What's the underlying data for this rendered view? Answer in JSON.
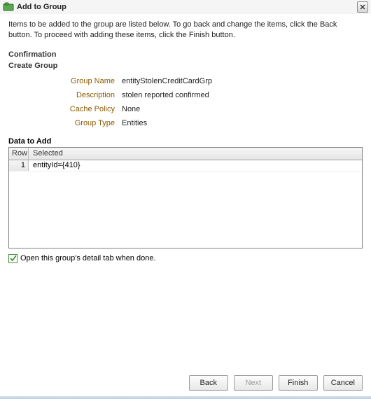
{
  "dialog": {
    "title": "Add to Group",
    "intro": "Items to be added to the group are listed below. To go back and change the items, click the Back button. To proceed with adding these items, click the Finish button."
  },
  "confirmation": {
    "heading": "Confirmation",
    "subheading": "Create Group",
    "fields": {
      "group_name": {
        "label": "Group Name",
        "value": "entityStolenCreditCardGrp"
      },
      "description": {
        "label": "Description",
        "value": "stolen reported confirmed"
      },
      "cache_policy": {
        "label": "Cache Policy",
        "value": "None"
      },
      "group_type": {
        "label": "Group Type",
        "value": "Entities"
      }
    }
  },
  "data_to_add": {
    "heading": "Data to Add",
    "columns": {
      "row": "Row",
      "selected": "Selected"
    },
    "rows": [
      {
        "n": "1",
        "selected": "entityId={410}"
      }
    ]
  },
  "options": {
    "open_detail_tab": {
      "label": "Open this group's detail tab when done.",
      "checked": true
    }
  },
  "buttons": {
    "back": "Back",
    "next": "Next",
    "finish": "Finish",
    "cancel": "Cancel"
  },
  "icons": {
    "app": "group-icon",
    "close": "close-icon"
  }
}
